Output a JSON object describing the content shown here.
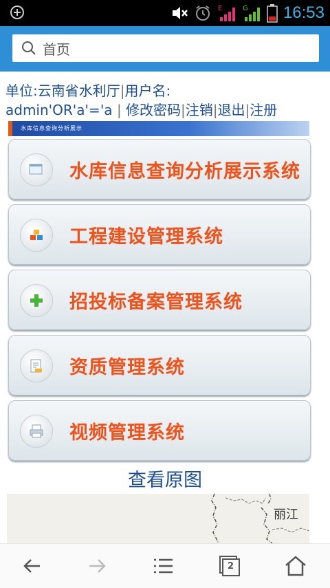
{
  "status_bar": {
    "time": "16:53",
    "network_e": "E",
    "network_g": "G"
  },
  "browser": {
    "url_text": "首页"
  },
  "info": {
    "unit_label": "单位:",
    "unit_value": "云南省水利厅",
    "user_label": "用户名:",
    "user_value": "admin'OR'a'='a",
    "change_password": "修改密码",
    "logout": "注销",
    "exit": "退出",
    "register": "注册"
  },
  "banner": {
    "text": "水库信息查询分析展示"
  },
  "menu": [
    {
      "label": "水库信息查询分析展示系统",
      "icon": "window-icon"
    },
    {
      "label": "工程建设管理系统",
      "icon": "blocks-icon"
    },
    {
      "label": "招投标备案管理系统",
      "icon": "plus-icon"
    },
    {
      "label": "资质管理系统",
      "icon": "document-icon"
    },
    {
      "label": "视频管理系统",
      "icon": "printer-icon"
    }
  ],
  "view_original": "查看原图",
  "map": {
    "label": "丽江"
  },
  "bottom_nav": {
    "tab_count": "2"
  },
  "colors": {
    "url_bar": "#2e8ed6",
    "menu_label": "#f0521a",
    "link": "#1c4e9a",
    "time": "#35b5e5"
  }
}
